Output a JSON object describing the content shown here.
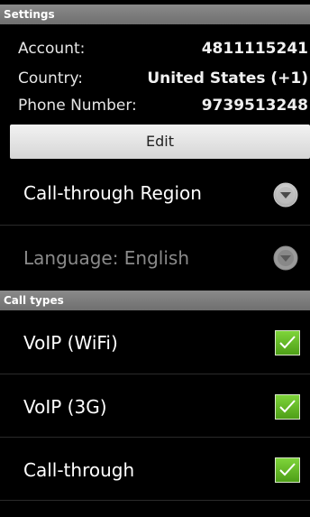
{
  "settings_header": "Settings",
  "account": {
    "label": "Account:",
    "value": "4811115241"
  },
  "country": {
    "label": "Country:",
    "value": "United States (+1)"
  },
  "phone": {
    "label": "Phone Number:",
    "value": "9739513248"
  },
  "edit_label": "Edit",
  "call_through_region": {
    "label": "Call-through Region",
    "icon": "dropdown-arrow-icon"
  },
  "language": {
    "label": "Language: English",
    "icon": "dropdown-arrow-icon",
    "enabled": false
  },
  "call_types_header": "Call types",
  "call_types": [
    {
      "label": "VoIP (WiFi)",
      "checked": true
    },
    {
      "label": "VoIP (3G)",
      "checked": true
    },
    {
      "label": "Call-through",
      "checked": true
    }
  ],
  "colors": {
    "background": "#000000",
    "header_bg": "#7a7a7a",
    "checkbox_green": "#5fb523",
    "disabled_text": "#8a8a8a"
  }
}
